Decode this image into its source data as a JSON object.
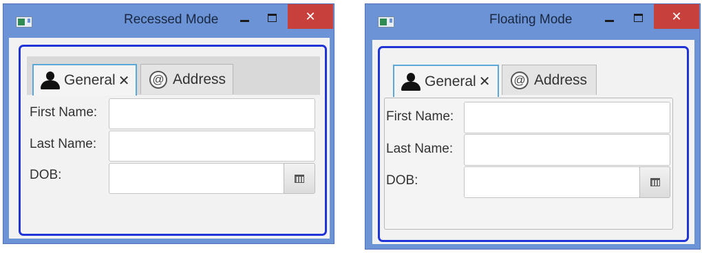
{
  "windows": [
    {
      "title": "Recessed Mode",
      "close_glyph": "✕",
      "tabs": [
        {
          "label": "General",
          "close_glyph": "✕",
          "icon": "person-icon",
          "selected": true
        },
        {
          "label": "Address",
          "icon": "at-icon",
          "selected": false
        }
      ],
      "form": {
        "first_name_label": "First Name:",
        "first_name_value": "",
        "last_name_label": "Last Name:",
        "last_name_value": "",
        "dob_label": "DOB:",
        "dob_value": ""
      }
    },
    {
      "title": "Floating Mode",
      "close_glyph": "✕",
      "tabs": [
        {
          "label": "General",
          "close_glyph": "✕",
          "icon": "person-icon",
          "selected": true
        },
        {
          "label": "Address",
          "icon": "at-icon",
          "selected": false
        }
      ],
      "form": {
        "first_name_label": "First Name:",
        "first_name_value": "",
        "last_name_label": "Last Name:",
        "last_name_value": "",
        "dob_label": "DOB:",
        "dob_value": ""
      }
    }
  ],
  "icons": {
    "at_glyph": "@"
  },
  "colors": {
    "titlebar": "#6b93d6",
    "close_button": "#c8403c",
    "focus_ring": "#1f33d6",
    "selected_tab_border": "#5ba8d8"
  }
}
